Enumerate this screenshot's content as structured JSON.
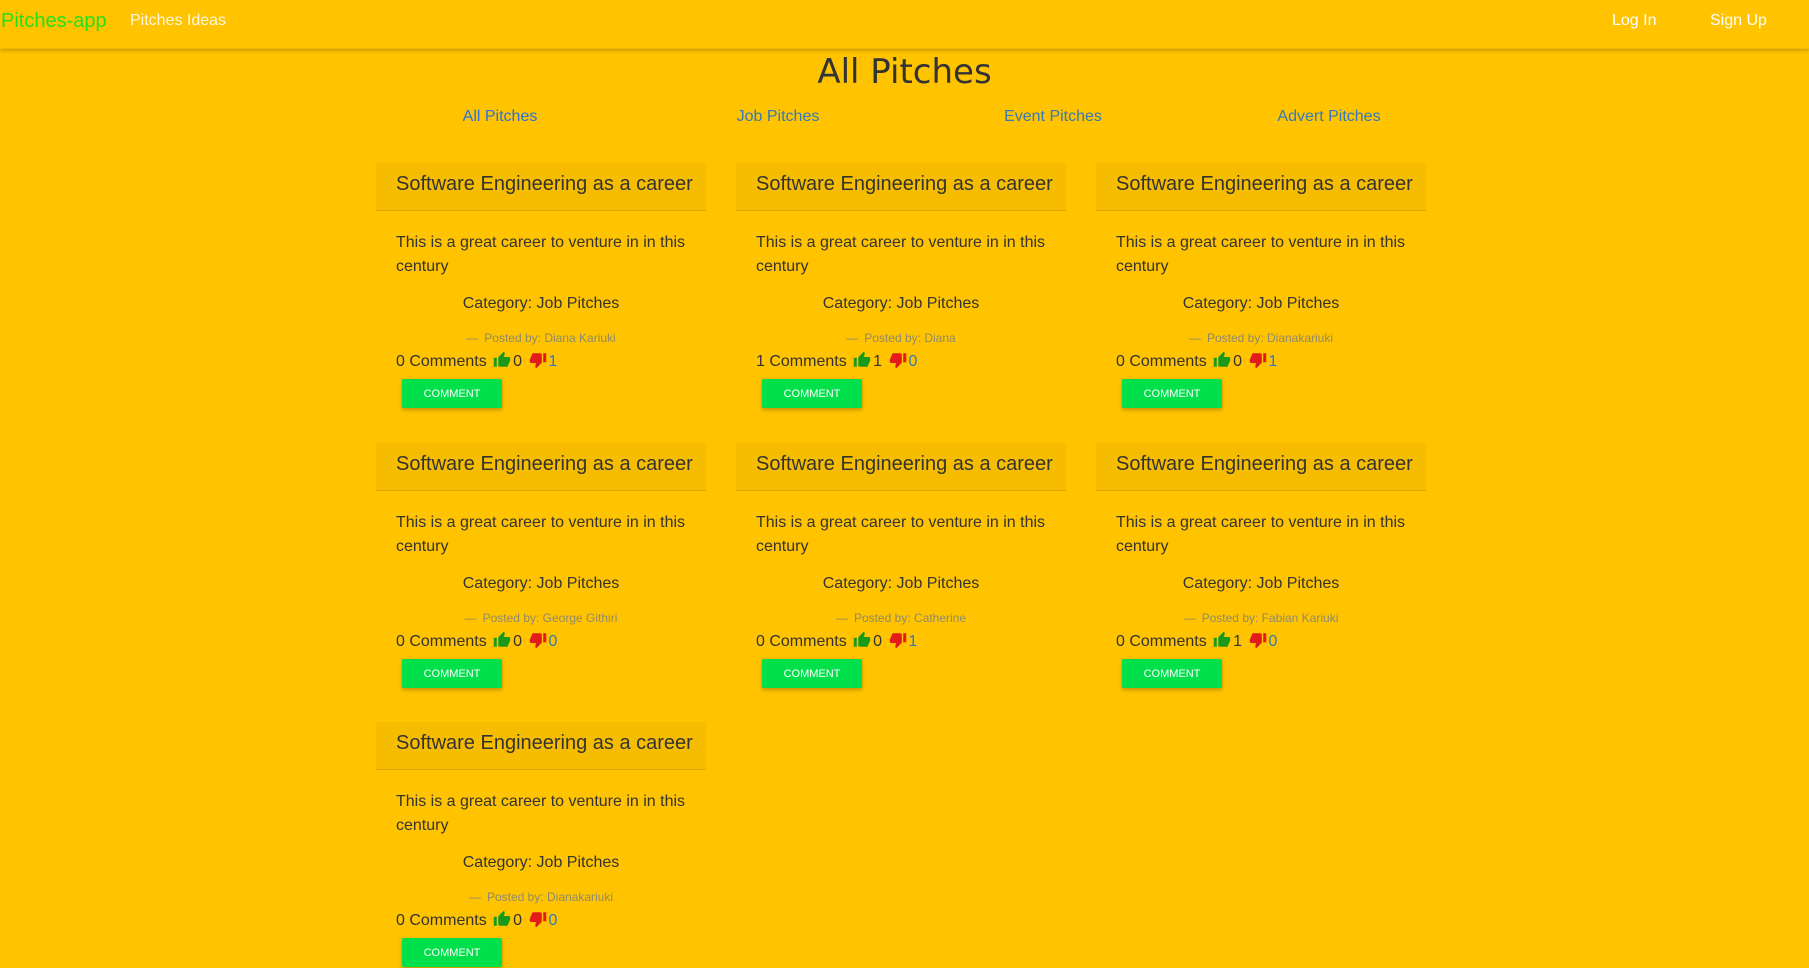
{
  "nav": {
    "brand": "Pitches-app",
    "ideas_link": "Pitches Ideas",
    "login": "Log In",
    "signup": "Sign Up"
  },
  "page": {
    "title": "All Pitches"
  },
  "tabs": [
    "All Pitches",
    "Job Pitches",
    "Event Pitches",
    "Advert Pitches"
  ],
  "pitches": [
    {
      "title": "Software Engineering as a career",
      "body": "This is a great career to venture in in this century",
      "category": "Category: Job Pitches",
      "posted": "Posted by: Diana Kariuki",
      "comments": "0 Comments",
      "upvotes": "0",
      "downvotes": "1",
      "button": "COMMENT"
    },
    {
      "title": "Software Engineering as a career",
      "body": "This is a great career to venture in in this century",
      "category": "Category: Job Pitches",
      "posted": "Posted by: Diana",
      "comments": "1 Comments",
      "upvotes": "1",
      "downvotes": "0",
      "button": "COMMENT"
    },
    {
      "title": "Software Engineering as a career",
      "body": "This is a great career to venture in in this century",
      "category": "Category: Job Pitches",
      "posted": "Posted by: Dianakariuki",
      "comments": "0 Comments",
      "upvotes": "0",
      "downvotes": "1",
      "button": "COMMENT"
    },
    {
      "title": "Software Engineering as a career",
      "body": "This is a great career to venture in in this century",
      "category": "Category: Job Pitches",
      "posted": "Posted by: George Githiri",
      "comments": "0 Comments",
      "upvotes": "0",
      "downvotes": "0",
      "button": "COMMENT"
    },
    {
      "title": "Software Engineering as a career",
      "body": "This is a great career to venture in in this century",
      "category": "Category: Job Pitches",
      "posted": "Posted by: Catherine",
      "comments": "0 Comments",
      "upvotes": "0",
      "downvotes": "1",
      "button": "COMMENT"
    },
    {
      "title": "Software Engineering as a career",
      "body": "This is a great career to venture in in this century",
      "category": "Category: Job Pitches",
      "posted": "Posted by: Fabian Kariuki",
      "comments": "0 Comments",
      "upvotes": "1",
      "downvotes": "0",
      "button": "COMMENT"
    },
    {
      "title": "Software Engineering as a career",
      "body": "This is a great career to venture in in this century",
      "category": "Category: Job Pitches",
      "posted": "Posted by: Dianakariuki",
      "comments": "0 Comments",
      "upvotes": "0",
      "downvotes": "0",
      "button": "COMMENT"
    }
  ],
  "icons": {
    "upvote": "thumbs-up-icon",
    "downvote": "thumbs-down-icon"
  },
  "colors": {
    "background": "#ffc300",
    "brand": "#22e01c",
    "button": "#00e04a",
    "thumb_up": "#1a9a1a",
    "thumb_down": "#e31b1b",
    "link": "#337ab7"
  }
}
